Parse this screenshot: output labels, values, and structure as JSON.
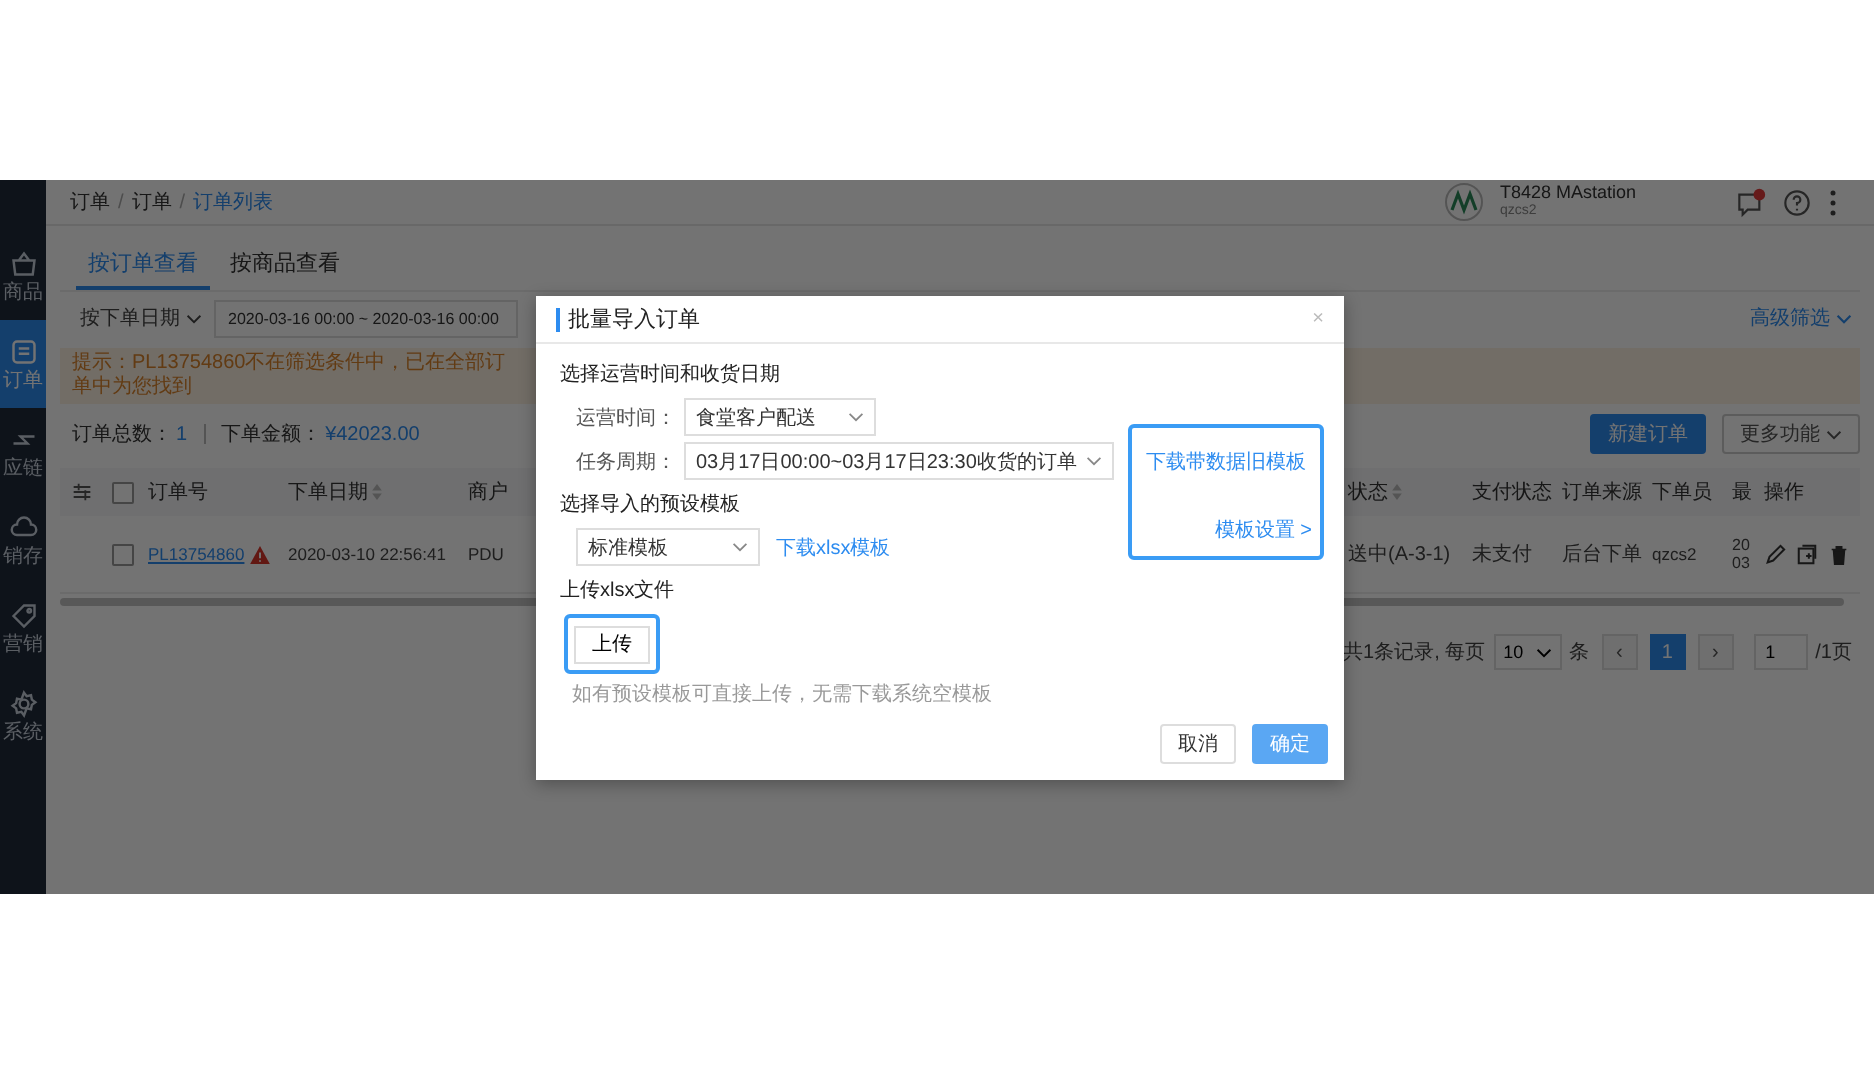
{
  "sidebar": {
    "items": [
      {
        "label": "商品",
        "kind": "basket",
        "selected": false
      },
      {
        "label": "订单",
        "kind": "document",
        "selected": true
      },
      {
        "label": "应链",
        "kind": "arrows",
        "selected": false
      },
      {
        "label": "销存",
        "kind": "cloud",
        "selected": false
      },
      {
        "label": "营销",
        "kind": "tag",
        "selected": false
      },
      {
        "label": "系统",
        "kind": "gear",
        "selected": false
      }
    ]
  },
  "header": {
    "breadcrumb": [
      "订单",
      "订单",
      "订单列表"
    ],
    "breadcrumb_separator": "/",
    "account": {
      "name": "T8428 MAstation",
      "user": "qzcs2"
    },
    "has_notification": true
  },
  "tabs": [
    {
      "label": "按订单查看",
      "selected": true
    },
    {
      "label": "按商品查看",
      "selected": false
    }
  ],
  "filter": {
    "date_type": "按下单日期",
    "date_range": "2020-03-16 00:00 ~ 2020-03-16 00:00",
    "advanced": "高级筛选"
  },
  "tip": "提示：PL13754860不在筛选条件中，已在全部订单中为您找到",
  "summary": {
    "count_label": "订单总数：",
    "count": "1",
    "amount_label": "下单金额：",
    "amount": "¥42023.00"
  },
  "actions": [
    {
      "label": "新建订单",
      "kind": "primary"
    },
    {
      "label": "更多功能",
      "kind": "dropdown"
    }
  ],
  "table": {
    "select_all_checked": false,
    "columns": [
      {
        "label": "订单号",
        "sortable": false
      },
      {
        "label": "下单日期",
        "sortable": true
      },
      {
        "label": "商户",
        "sortable": false
      },
      {
        "label": "状态",
        "sortable": true
      },
      {
        "label": "支付状态",
        "sortable": false
      },
      {
        "label": "订单来源",
        "sortable": false
      },
      {
        "label": "下单员",
        "sortable": false
      },
      {
        "label": "最",
        "sortable": false
      },
      {
        "label": "操作",
        "sortable": false
      }
    ],
    "rows": [
      {
        "checked": false,
        "order_no": "PL13754860",
        "warning": true,
        "date": "2020-03-10 22:56:41",
        "merchant": "PDU",
        "status": "送中(A-3-1)",
        "payment": "未支付",
        "source": "后台下单",
        "creator": "qzcs2",
        "column_8": [
          "20",
          "03"
        ]
      }
    ]
  },
  "pagination": {
    "total": "共1条记录, 每页",
    "page_size": "10",
    "unit": "条",
    "prev": "‹",
    "pages": [
      {
        "label": "1",
        "selected": true
      }
    ],
    "next": "›",
    "page_input": "1",
    "page_total": "/1页"
  },
  "dialog": {
    "title": "批量导入订单",
    "close": "×",
    "section_time": "选择运营时间和收货日期",
    "fields": [
      {
        "label": "运营时间：",
        "value": "食堂客户配送"
      },
      {
        "label": "任务周期：",
        "value": "03月17日00:00~03月17日23:30收货的订单"
      }
    ],
    "section_template": "选择导入的预设模板",
    "template": "标准模板",
    "download_template": "下载xlsx模板",
    "old_template": {
      "link": "下载带数据旧模板",
      "settings": "模板设置 >",
      "highlighted": true
    },
    "upload_label": "上传xlsx文件",
    "upload": {
      "button": "上传",
      "highlighted": true
    },
    "upload_hint": "如有预设模板可直接上传，无需下载系统空模板",
    "buttons": [
      {
        "label": "取消",
        "kind": "default"
      },
      {
        "label": "确定",
        "kind": "primary"
      }
    ]
  }
}
